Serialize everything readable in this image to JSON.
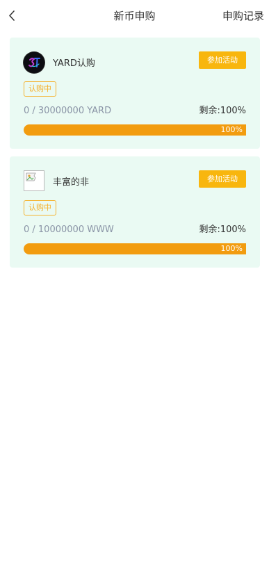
{
  "header": {
    "title": "新币申购",
    "records_label": "申购记录",
    "back_icon": "chevron-left-icon"
  },
  "cards": [
    {
      "name": "YARD认购",
      "logo_icon": "coin-logo",
      "action_label": "参加活动",
      "status": "认购中",
      "amount": "0 / 30000000 YARD",
      "remaining": "剩余:100%",
      "progress_percent": 100,
      "progress_label": "100%"
    },
    {
      "name": "丰富的非",
      "logo_icon": "broken-image-icon",
      "action_label": "参加活动",
      "status": "认购中",
      "amount": "0 / 10000000 WWW",
      "remaining": "剩余:100%",
      "progress_percent": 100,
      "progress_label": "100%"
    }
  ],
  "colors": {
    "accent": "#f8b60e",
    "card_background": "#eafaf3",
    "progress_fill": "#f29c0f",
    "badge": "#f5b22f"
  }
}
